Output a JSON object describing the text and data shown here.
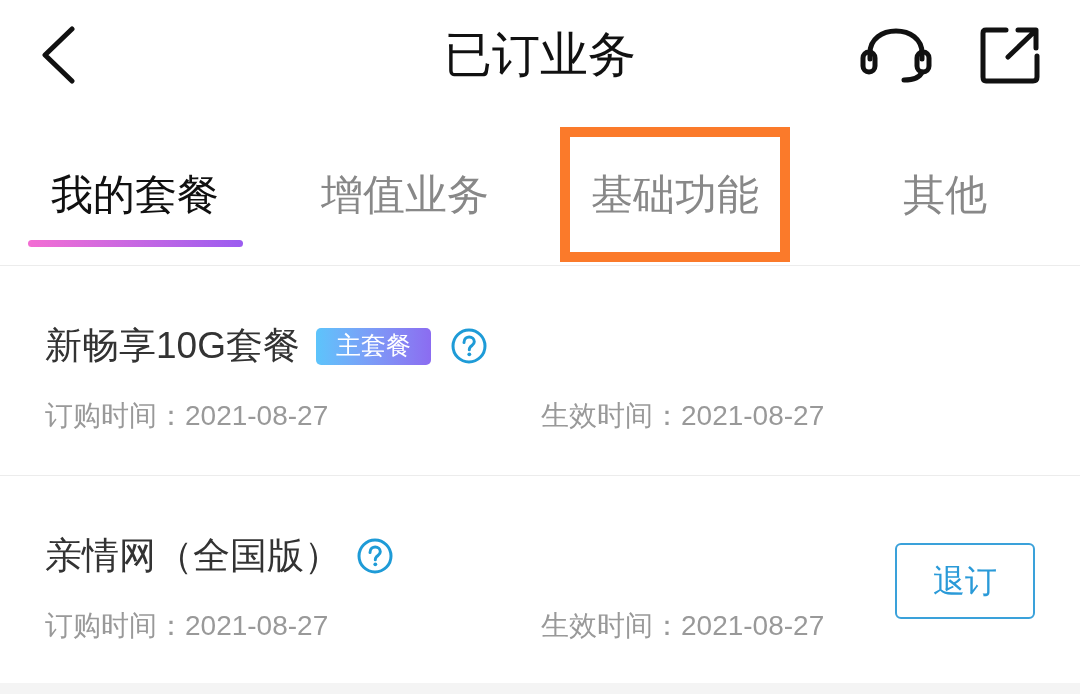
{
  "header": {
    "title": "已订业务"
  },
  "tabs": [
    {
      "label": "我的套餐",
      "selected": true,
      "highlighted": false
    },
    {
      "label": "增值业务",
      "selected": false,
      "highlighted": false
    },
    {
      "label": "基础功能",
      "selected": false,
      "highlighted": true
    },
    {
      "label": "其他",
      "selected": false,
      "highlighted": false
    }
  ],
  "services": [
    {
      "name": "新畅享10G套餐",
      "badge": "主套餐",
      "order_date": "订购时间：2021-08-27",
      "effective_date": "生效时间：2021-08-27"
    },
    {
      "name": "亲情网（全国版）",
      "action": "退订",
      "order_date": "订购时间：2021-08-27",
      "effective_date": "生效时间：2021-08-27"
    }
  ]
}
